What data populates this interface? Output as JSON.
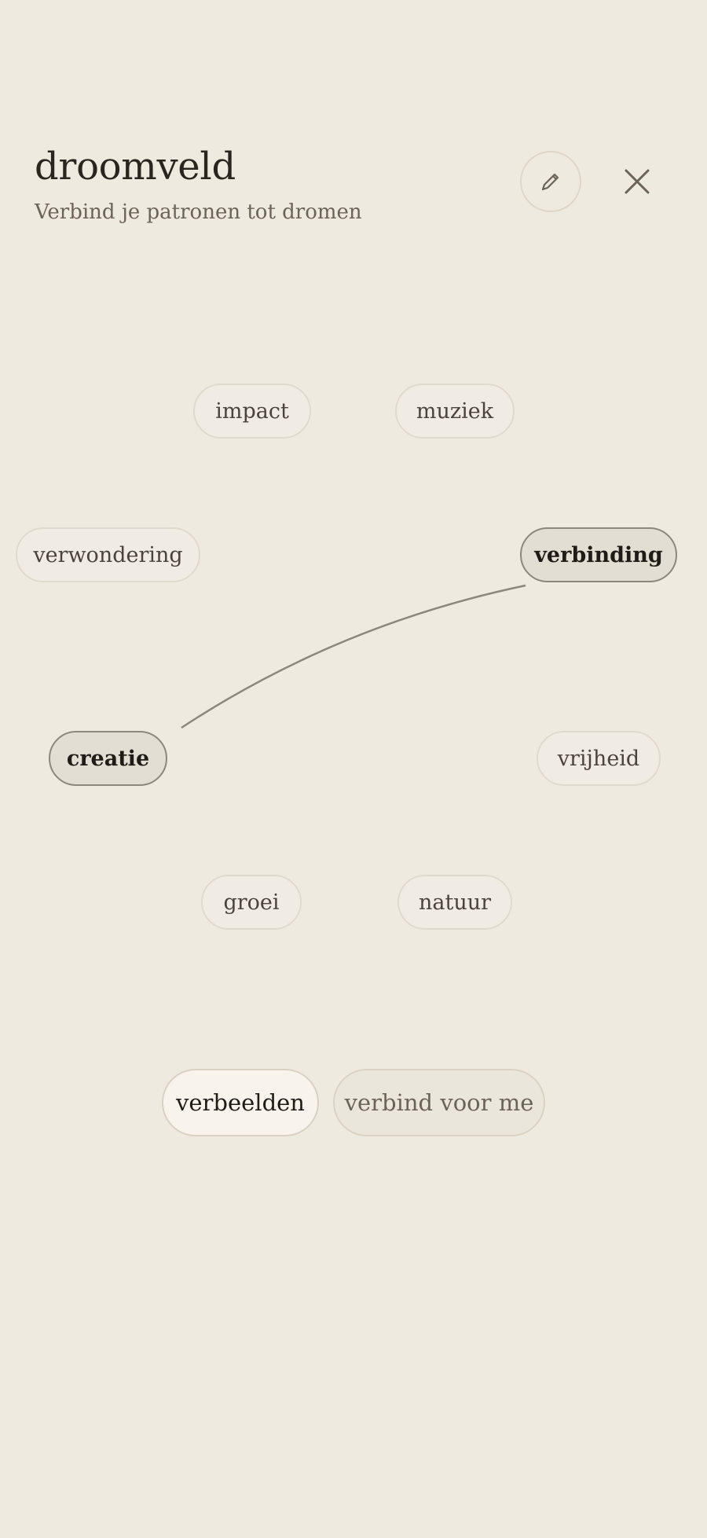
{
  "header": {
    "title": "droomveld",
    "subtitle": "Verbind je patronen tot dromen"
  },
  "icons": {
    "edit": "pencil-icon",
    "close": "close-icon"
  },
  "field": {
    "words": [
      {
        "label": "impact",
        "selected": false
      },
      {
        "label": "muziek",
        "selected": false
      },
      {
        "label": "verwondering",
        "selected": false
      },
      {
        "label": "verbinding",
        "selected": true
      },
      {
        "label": "creatie",
        "selected": true
      },
      {
        "label": "vrijheid",
        "selected": false
      },
      {
        "label": "groei",
        "selected": false
      },
      {
        "label": "natuur",
        "selected": false
      }
    ],
    "connection": {
      "from": "creatie",
      "to": "verbinding"
    }
  },
  "actions": {
    "examples_label": "verbeelden",
    "connect_label": "verbind voor me"
  },
  "colors": {
    "background": "#efeae0",
    "chip": "#f1ece3",
    "chip_selected": "#e3ded3",
    "line": "#8c877b",
    "text": "#2a251f",
    "muted_text": "#6b6357"
  }
}
